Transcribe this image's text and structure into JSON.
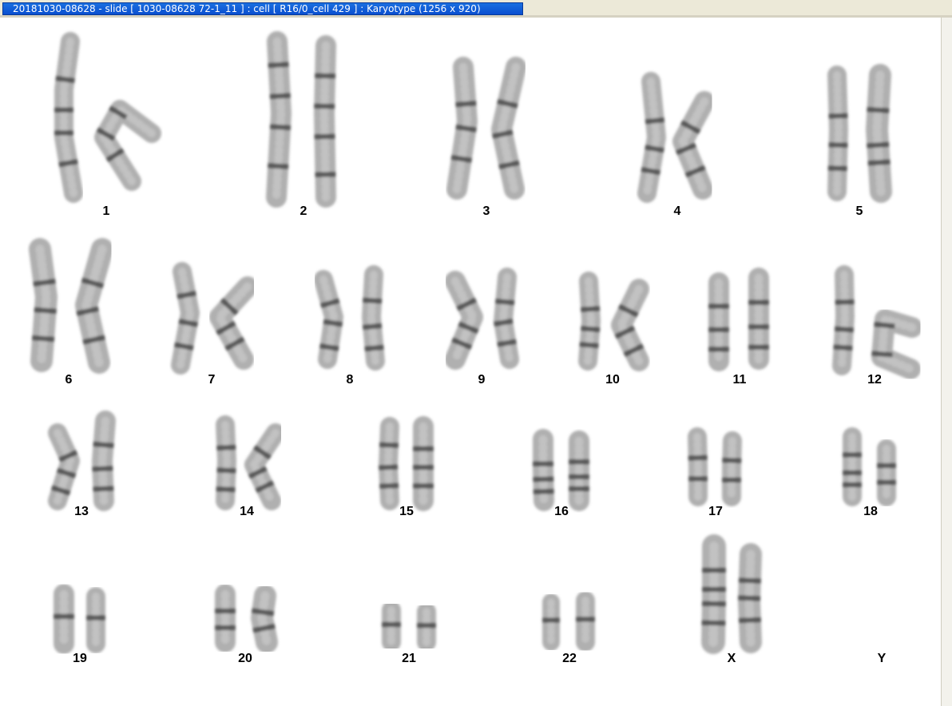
{
  "window": {
    "title": "20181030-08628 - slide [ 1030-08628 72-1_11 ] : cell [ R16/0_cell 429 ] : Karyotype  (1256 x 920)"
  },
  "karyotype": {
    "pairs": [
      {
        "label": "1"
      },
      {
        "label": "2"
      },
      {
        "label": "3"
      },
      {
        "label": "4"
      },
      {
        "label": "5"
      },
      {
        "label": "6"
      },
      {
        "label": "7"
      },
      {
        "label": "8"
      },
      {
        "label": "9"
      },
      {
        "label": "10"
      },
      {
        "label": "11"
      },
      {
        "label": "12"
      },
      {
        "label": "13"
      },
      {
        "label": "14"
      },
      {
        "label": "15"
      },
      {
        "label": "16"
      },
      {
        "label": "17"
      },
      {
        "label": "18"
      },
      {
        "label": "19"
      },
      {
        "label": "20"
      },
      {
        "label": "21"
      },
      {
        "label": "22"
      },
      {
        "label": "X"
      },
      {
        "label": "Y"
      }
    ]
  },
  "colors": {
    "title_bg": "#0a4fd0",
    "title_text": "#ffffff",
    "canvas": "#ffffff",
    "chromosome": "#6e6e6e",
    "band": "#3a3a3a"
  }
}
